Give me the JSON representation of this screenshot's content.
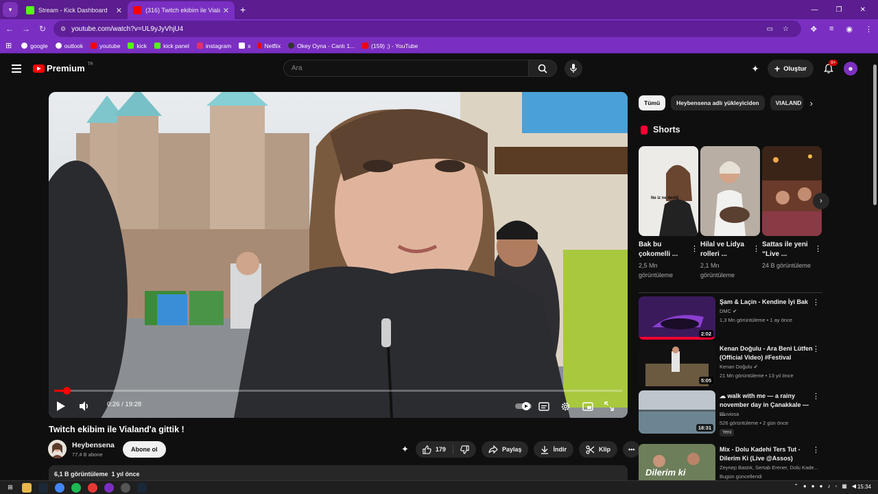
{
  "browser": {
    "tabs": [
      {
        "title": "Stream - Kick Dashboard",
        "favicon_color": "#53fc18",
        "active": false
      },
      {
        "title": "(316) Twitch ekibim ile Vialand'...",
        "favicon_color": "#ff0000",
        "active": true
      }
    ],
    "url": "youtube.com/watch?v=UL9yJyVhjU4",
    "bookmarks": [
      {
        "label": "google",
        "color": "#ffffff"
      },
      {
        "label": "outlook",
        "color": "#ffffff"
      },
      {
        "label": "youtube",
        "color": "#ff0000"
      },
      {
        "label": "kick",
        "color": "#53fc18"
      },
      {
        "label": "kick panel",
        "color": "#53fc18"
      },
      {
        "label": "instagram",
        "color": "#e1306c"
      },
      {
        "label": "x",
        "color": "#ffffff"
      },
      {
        "label": "Netflix",
        "color": "#e50914"
      },
      {
        "label": "Okey Oyna - Canlı 1...",
        "color": "#333333"
      },
      {
        "label": "(159) ;) - YouTube",
        "color": "#ff0000"
      }
    ]
  },
  "masthead": {
    "logo_text": "Premium",
    "region": "TR",
    "search_placeholder": "Ara",
    "create_label": "Oluştur",
    "notif_count": "9+"
  },
  "player": {
    "time": "0:26 / 19:28",
    "progress_fraction": 0.022
  },
  "video": {
    "title": "Twitch ekibim ile Vialand'a gittik !",
    "channel": "Heybensena",
    "subscribers": "77,4 B abone",
    "subscribe_label": "Abone ol",
    "likes": "179",
    "share_label": "Paylaş",
    "download_label": "İndir",
    "clip_label": "Klip",
    "views_date": "6,1 B görüntüleme  1 yıl önce"
  },
  "sidebar": {
    "chips": [
      "Tümü",
      "Heybensena adlı yükleyiciden",
      "VIALAND"
    ],
    "shorts_heading": "Shorts",
    "shorts": [
      {
        "title": "Bak bu çokomelli ...",
        "views": "2,5 Mn görüntüleme",
        "thumb_text": "Ne iz ne dediğ"
      },
      {
        "title": "Hilal ve Lidya rolleri ...",
        "views": "2,1 Mn görüntüleme"
      },
      {
        "title": "Sattas ile yeni “Live ...",
        "views": "24 B görüntüleme"
      }
    ],
    "recommendations": [
      {
        "title": "Şam & Laçin - Kendine İyi Bak",
        "channel": "DMC",
        "verified": true,
        "meta": "1,3 Mn görüntüleme • 1 ay önce",
        "duration": "2:02",
        "new": ""
      },
      {
        "title": "Kenan Doğulu - Ara Beni Lütfen (Official Video) #Festival",
        "channel": "Kenan Doğulu",
        "verified": true,
        "meta": "21 Mn görüntüleme • 13 yıl önce",
        "duration": "5:05",
        "new": ""
      },
      {
        "title": "☁ walk with me — a rainy november day in Çanakkale — ...",
        "channel": "Pluviosa",
        "verified": false,
        "meta": "526 görüntüleme • 2 gün önce",
        "duration": "18:31",
        "new": "Yeni"
      },
      {
        "title": "Mix - Dolu Kadehi Ters Tut - Dilerim Ki (Live @Assos)",
        "channel": "Zeynep Bastık, Sertab Erener, Dolu Kade...",
        "verified": false,
        "meta": "Bugün güncellendi",
        "duration": "",
        "new": "",
        "thumb_text": "Dilerim ki"
      }
    ]
  },
  "taskbar": {
    "clock": "15:34"
  }
}
